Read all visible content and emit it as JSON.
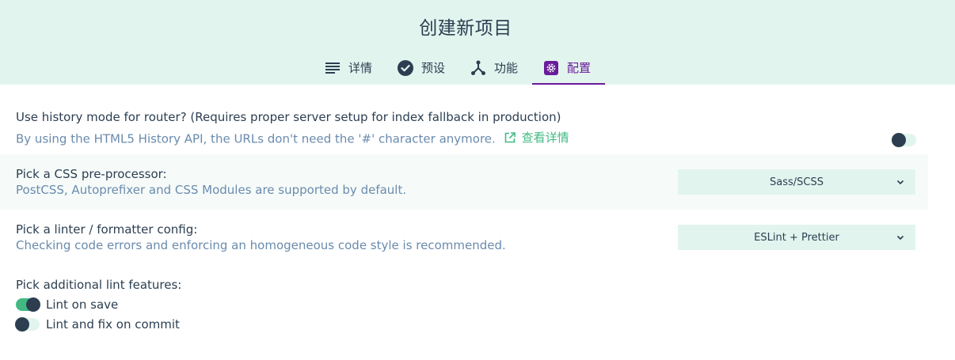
{
  "header": {
    "title": "创建新项目",
    "tabs": [
      {
        "label": "详情",
        "icon": "list-icon"
      },
      {
        "label": "预设",
        "icon": "check-circle-icon"
      },
      {
        "label": "功能",
        "icon": "fork-icon"
      },
      {
        "label": "配置",
        "icon": "settings-icon",
        "active": true
      }
    ]
  },
  "history_mode": {
    "title": "Use history mode for router? (Requires proper server setup for index fallback in production)",
    "description": "By using the HTML5 History API, the URLs don't need the '#' character anymore.",
    "link_label": "查看详情",
    "enabled": false
  },
  "css_preprocessor": {
    "title": "Pick a CSS pre-processor:",
    "description": "PostCSS, Autoprefixer and CSS Modules are supported by default.",
    "selected": "Sass/SCSS"
  },
  "linter": {
    "title": "Pick a linter / formatter config:",
    "description": "Checking code errors and enforcing an homogeneous code style is recommended.",
    "selected": "ESLint + Prettier"
  },
  "lint_features": {
    "title": "Pick additional lint features:",
    "items": [
      {
        "label": "Lint on save",
        "enabled": true
      },
      {
        "label": "Lint and fix on commit",
        "enabled": false
      }
    ]
  },
  "colors": {
    "header_bg": "#e2f4ee",
    "accent_green": "#42b983",
    "accent_purple": "#6a1b9a",
    "text_dark": "#2c3e50",
    "text_muted": "#6a8bad"
  }
}
